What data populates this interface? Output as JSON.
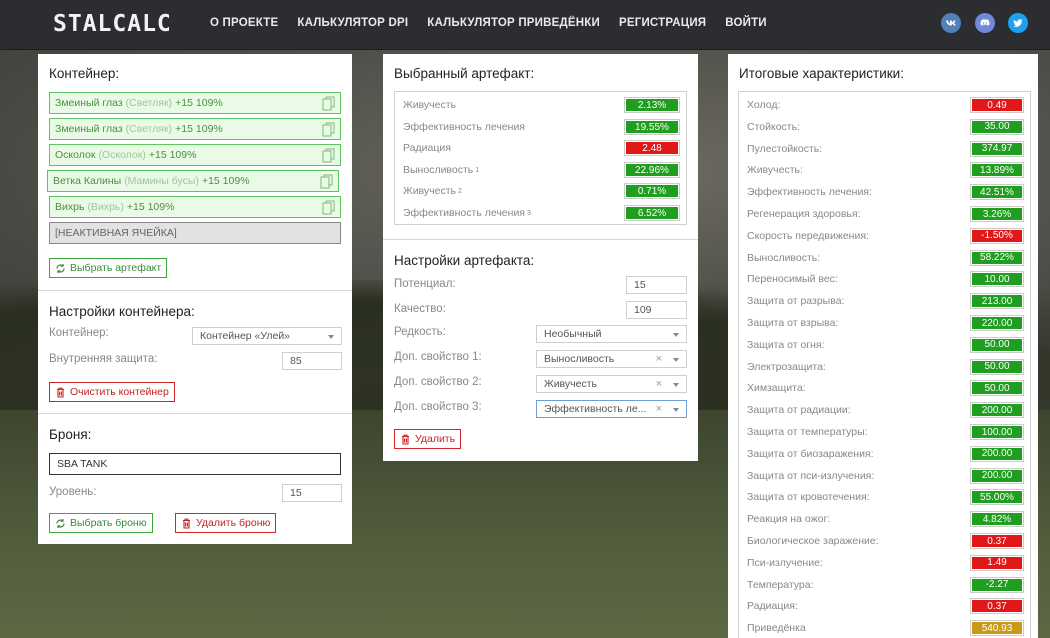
{
  "header": {
    "logo": "STALCALC",
    "nav": [
      "О ПРОЕКТЕ",
      "КАЛЬКУЛЯТОР DPI",
      "КАЛЬКУЛЯТОР ПРИВЕДЁНКИ",
      "РЕГИСТРАЦИЯ",
      "ВОЙТИ"
    ],
    "social_icons": [
      "vk-icon",
      "discord-icon",
      "twitter-icon"
    ]
  },
  "container": {
    "title": "Контейнер:",
    "slots": [
      {
        "name": "Змеиный глаз",
        "sub": "(Светляк)",
        "level": "+15 109%"
      },
      {
        "name": "Змеиный глаз",
        "sub": "(Светляк)",
        "level": "+15 109%"
      },
      {
        "name": "Осколок",
        "sub": "(Осколок)",
        "level": "+15 109%"
      },
      {
        "name": "Ветка Калины",
        "sub": "(Мамины бусы)",
        "level": "+15 109%"
      },
      {
        "name": "Вихрь",
        "sub": "(Вихрь)",
        "level": "+15 109%"
      }
    ],
    "inactive_slot": "[НЕАКТИВНАЯ ЯЧЕЙКА]",
    "select_button": "Выбрать артефакт"
  },
  "container_settings": {
    "title": "Настройки контейнера:",
    "container_label": "Контейнер:",
    "container_value": "Контейнер «Улей»",
    "protection_label": "Внутренняя защита:",
    "protection_value": "85",
    "clear_button": "Очистить контейнер"
  },
  "armor": {
    "title": "Броня:",
    "name": "SBA TANK",
    "level_label": "Уровень:",
    "level_value": "15",
    "select_button": "Выбрать броню",
    "delete_button": "Удалить броню"
  },
  "selected_artifact": {
    "title": "Выбранный артефакт:",
    "stats": [
      {
        "label": "Живучесть",
        "sup": "",
        "value": "2.13%",
        "kind": "pos"
      },
      {
        "label": "Эффективность лечения",
        "sup": "",
        "value": "19.55%",
        "kind": "pos"
      },
      {
        "label": "Радиация",
        "sup": "",
        "value": "2.48",
        "kind": "neg"
      },
      {
        "label": "Выносливость",
        "sup": "1",
        "value": "22.96%",
        "kind": "pos"
      },
      {
        "label": "Живучесть",
        "sup": "2",
        "value": "0.71%",
        "kind": "pos"
      },
      {
        "label": "Эффективность лечения",
        "sup": "3",
        "value": "6.52%",
        "kind": "pos"
      }
    ]
  },
  "artifact_settings": {
    "title": "Настройки артефакта:",
    "potential_label": "Потенциал:",
    "potential_value": "15",
    "quality_label": "Качество:",
    "quality_value": "109",
    "rarity_label": "Редкость:",
    "rarity_value": "Необычный",
    "extra1_label": "Доп. свойство 1:",
    "extra1_value": "Выносливость",
    "extra2_label": "Доп. свойство 2:",
    "extra2_value": "Живучесть",
    "extra3_label": "Доп. свойство 3:",
    "extra3_value": "Эффективность ле...",
    "delete_button": "Удалить"
  },
  "totals": {
    "title": "Итоговые характеристики:",
    "stats": [
      {
        "label": "Холод:",
        "value": "0.49",
        "kind": "neg"
      },
      {
        "label": "Стойкость:",
        "value": "35.00",
        "kind": "pos"
      },
      {
        "label": "Пулестойкость:",
        "value": "374.97",
        "kind": "pos"
      },
      {
        "label": "Живучесть:",
        "value": "13.89%",
        "kind": "pos"
      },
      {
        "label": "Эффективность лечения:",
        "value": "42.51%",
        "kind": "pos"
      },
      {
        "label": "Регенерация здоровья:",
        "value": "3.26%",
        "kind": "pos"
      },
      {
        "label": "Скорость передвижения:",
        "value": "-1.50%",
        "kind": "neg"
      },
      {
        "label": "Выносливость:",
        "value": "58.22%",
        "kind": "pos"
      },
      {
        "label": "Переносимый вес:",
        "value": "10.00",
        "kind": "pos"
      },
      {
        "label": "Защита от разрыва:",
        "value": "213.00",
        "kind": "pos"
      },
      {
        "label": "Защита от взрыва:",
        "value": "220.00",
        "kind": "pos"
      },
      {
        "label": "Защита от огня:",
        "value": "50.00",
        "kind": "pos"
      },
      {
        "label": "Электрозащита:",
        "value": "50.00",
        "kind": "pos"
      },
      {
        "label": "Химзащита:",
        "value": "50.00",
        "kind": "pos"
      },
      {
        "label": "Защита от радиации:",
        "value": "200.00",
        "kind": "pos"
      },
      {
        "label": "Защита от температуры:",
        "value": "100.00",
        "kind": "pos"
      },
      {
        "label": "Защита от биозаражения:",
        "value": "200.00",
        "kind": "pos"
      },
      {
        "label": "Защита от пси-излучения:",
        "value": "200.00",
        "kind": "pos"
      },
      {
        "label": "Защита от кровотечения:",
        "value": "55.00%",
        "kind": "pos"
      },
      {
        "label": "Реакция на ожог:",
        "value": "4.82%",
        "kind": "pos"
      },
      {
        "label": "Биологическое заражение:",
        "value": "0.37",
        "kind": "neg"
      },
      {
        "label": "Пси-излучение:",
        "value": "1.49",
        "kind": "neg"
      },
      {
        "label": "Температура:",
        "value": "-2.27",
        "kind": "pos"
      },
      {
        "label": "Радиация:",
        "value": "0.37",
        "kind": "neg"
      },
      {
        "label": "Приведёнка",
        "value": "540.93",
        "kind": "gold"
      }
    ]
  },
  "colors": {
    "positive": "#1f9e1f",
    "negative": "#e01818",
    "gold": "#c99a16",
    "header": "#2b2d31"
  }
}
